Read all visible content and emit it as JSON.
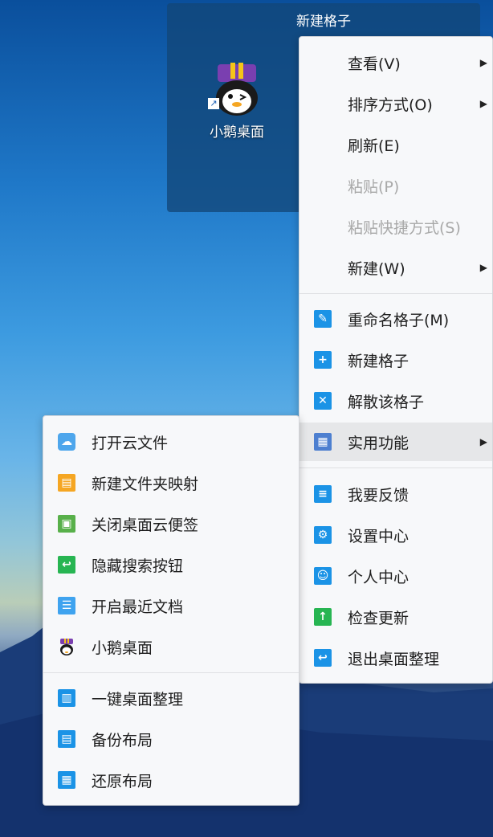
{
  "fence": {
    "title": "新建格子"
  },
  "desktop_icon": {
    "label": "小鹅桌面",
    "icon": "penguin-icon"
  },
  "context_menu": {
    "items": [
      {
        "label": "查看(V)",
        "submenu": true
      },
      {
        "label": "排序方式(O)",
        "submenu": true
      },
      {
        "label": "刷新(E)"
      },
      {
        "label": "粘贴(P)",
        "disabled": true
      },
      {
        "label": "粘贴快捷方式(S)",
        "disabled": true
      },
      {
        "label": "新建(W)",
        "submenu": true
      },
      {
        "label": "重命名格子(M)",
        "icon": "rename-icon"
      },
      {
        "label": "新建格子",
        "icon": "plus-icon"
      },
      {
        "label": "解散该格子",
        "icon": "dissolve-icon"
      },
      {
        "label": "实用功能",
        "icon": "monitor-icon",
        "submenu": true,
        "highlighted": true
      },
      {
        "label": "我要反馈",
        "icon": "feedback-icon"
      },
      {
        "label": "设置中心",
        "icon": "gear-icon"
      },
      {
        "label": "个人中心",
        "icon": "user-icon"
      },
      {
        "label": "检查更新",
        "icon": "upload-arrow-icon"
      },
      {
        "label": "退出桌面整理",
        "icon": "exit-icon"
      }
    ]
  },
  "sub_menu": {
    "items": [
      {
        "label": "打开云文件",
        "icon": "cloud-icon"
      },
      {
        "label": "新建文件夹映射",
        "icon": "folder-icon"
      },
      {
        "label": "关闭桌面云便签",
        "icon": "note-icon"
      },
      {
        "label": "隐藏搜索按钮",
        "icon": "undo-icon"
      },
      {
        "label": "开启最近文档",
        "icon": "document-icon"
      },
      {
        "label": "小鹅桌面",
        "icon": "penguin-icon"
      },
      {
        "label": "一键桌面整理",
        "icon": "layout-icon"
      },
      {
        "label": "备份布局",
        "icon": "backup-layout-icon"
      },
      {
        "label": "还原布局",
        "icon": "restore-layout-icon"
      }
    ]
  }
}
